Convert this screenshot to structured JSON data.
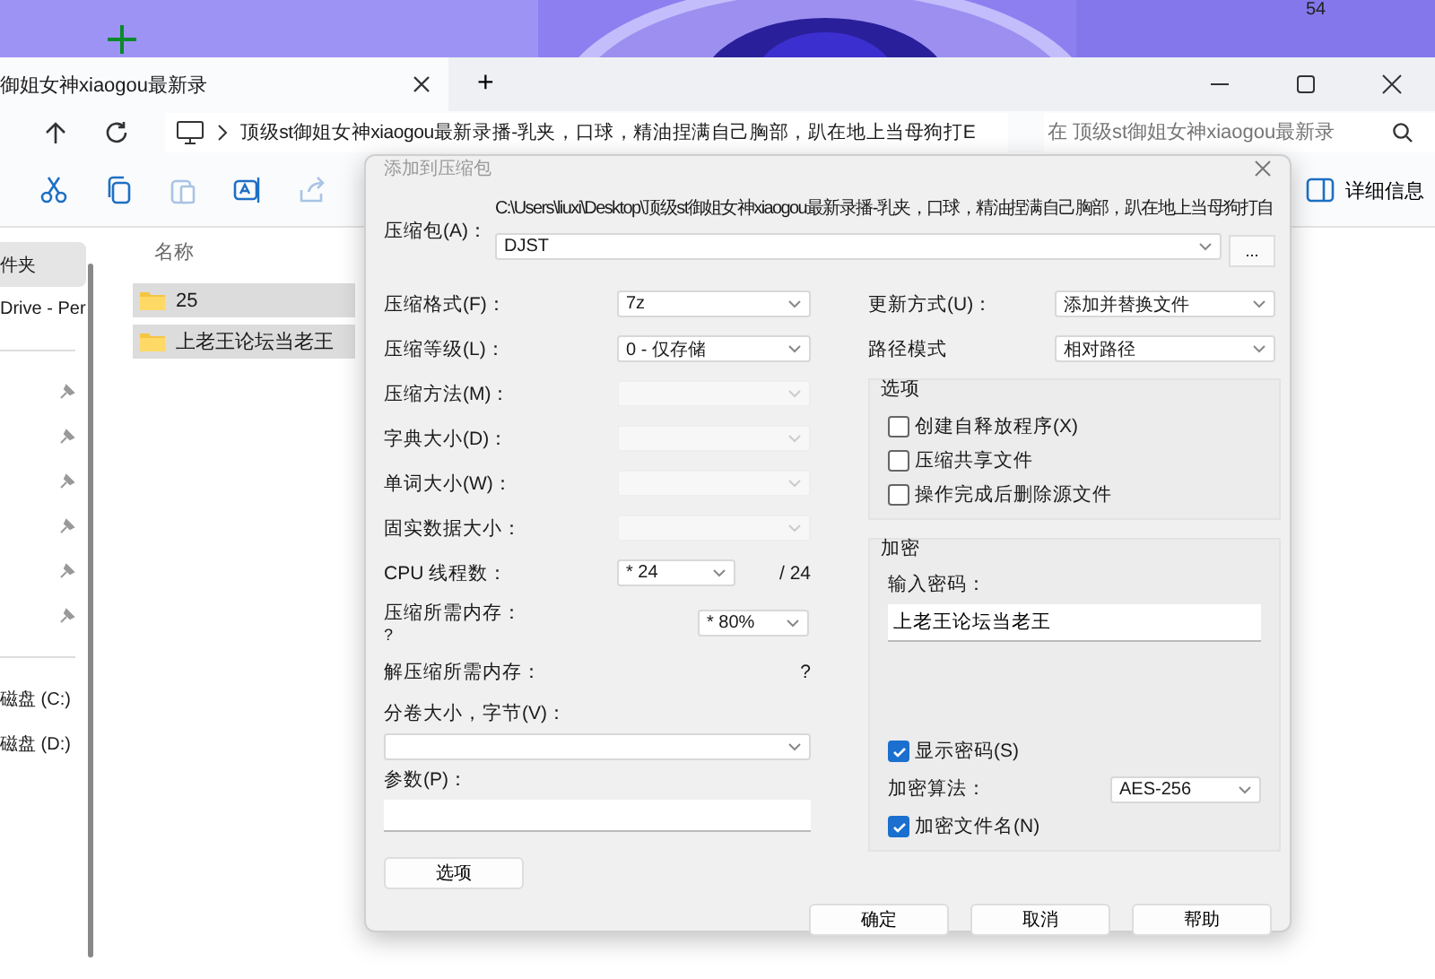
{
  "desktop": {
    "corner_text": "54"
  },
  "explorer": {
    "tab": {
      "title": "御姐女神xiaogou最新录",
      "selected": true
    },
    "new_tab": "+",
    "address": "顶级st御姐女神xiaogou最新录播-乳夹，口球，精油捏满自己胸部，趴在地上当母狗打E",
    "search_placeholder": "在 顶级st御姐女神xiaogou最新录",
    "details_button": "详细信息",
    "sidebar": [
      {
        "kind": "item",
        "label": "件夹",
        "selected": true
      },
      {
        "kind": "item",
        "label": "Drive - Per",
        "selected": false
      },
      {
        "kind": "divider"
      },
      {
        "kind": "pinned"
      },
      {
        "kind": "pinned"
      },
      {
        "kind": "pinned"
      },
      {
        "kind": "pinned"
      },
      {
        "kind": "pinned"
      },
      {
        "kind": "pinned"
      },
      {
        "kind": "divider"
      },
      {
        "kind": "item",
        "label": "磁盘 (C:)",
        "selected": false
      },
      {
        "kind": "item",
        "label": "磁盘 (D:)",
        "selected": false
      }
    ],
    "column_header": "名称",
    "files": [
      {
        "name": "25",
        "selected": true
      },
      {
        "name": "上老王论坛当老王",
        "selected": true
      }
    ]
  },
  "dialog": {
    "title": "添加到压缩包",
    "archive_label": "压缩包(A)：",
    "archive_path": "C:\\Users\\liuxi\\Desktop\\顶级st御姐女神xiaogou最新录播-乳夹，口球，精油捏满自己胸部，趴在地上当母狗打自",
    "archive_name": "DJST",
    "browse": "...",
    "left_rows": [
      {
        "kind": "combo",
        "label": "压缩格式(F)：",
        "value": "7z",
        "disabled": false
      },
      {
        "kind": "combo",
        "label": "压缩等级(L)：",
        "value": "0 - 仅存储",
        "disabled": false
      },
      {
        "kind": "combo",
        "label": "压缩方法(M)：",
        "disabled": true
      },
      {
        "kind": "combo",
        "label": "字典大小(D)：",
        "disabled": true
      },
      {
        "kind": "combo",
        "label": "单词大小(W)：",
        "disabled": true
      },
      {
        "kind": "combo",
        "label": "固实数据大小：",
        "disabled": true
      },
      {
        "kind": "threads",
        "label": "CPU 线程数：",
        "value": "* 24",
        "suffix": "/ 24"
      },
      {
        "kind": "memory",
        "label": "压缩所需内存：",
        "note": "?",
        "value": "* 80%"
      },
      {
        "kind": "info",
        "label": "解压缩所需内存：",
        "value": "?"
      },
      {
        "kind": "stacked_combo",
        "label": "分卷大小，字节(V)："
      },
      {
        "kind": "stacked_input",
        "label": "参数(P)："
      }
    ],
    "options_button": "选项",
    "right_rows": [
      {
        "label": "更新方式(U)：",
        "value": "添加并替换文件"
      },
      {
        "label": "路径模式",
        "value": "相对路径"
      }
    ],
    "options_group": {
      "title": "选项",
      "checks": [
        {
          "label": "创建自释放程序(X)",
          "checked": false
        },
        {
          "label": "压缩共享文件",
          "checked": false
        },
        {
          "label": "操作完成后删除源文件",
          "checked": false
        }
      ]
    },
    "encryption": {
      "title": "加密",
      "password_label": "输入密码：",
      "password": "上老王论坛当老王",
      "show_password": {
        "label": "显示密码(S)",
        "checked": true
      },
      "method_label": "加密算法：",
      "method": "AES-256",
      "encrypt_names": {
        "label": "加密文件名(N)",
        "checked": true
      }
    },
    "buttons": [
      "确定",
      "取消",
      "帮助"
    ]
  }
}
